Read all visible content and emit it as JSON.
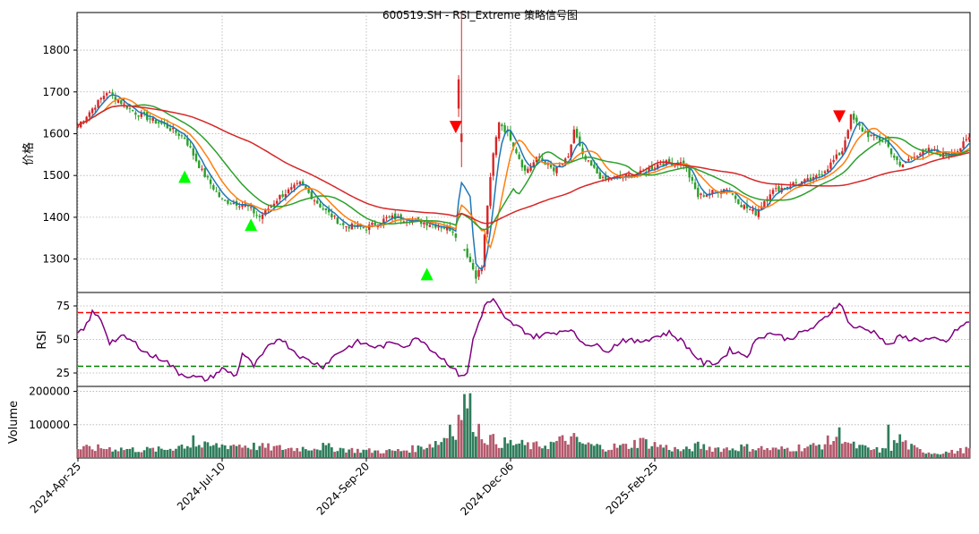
{
  "chart_data": {
    "type": "candlestick",
    "title": "600519.SH - RSI_Extreme 策略信号图",
    "grid": true,
    "x_ticks": [
      "2024-Apr-25",
      "2024-Jul-10",
      "2024-Sep-20",
      "2024-Dec-06",
      "2025-Feb-25"
    ],
    "price": {
      "ylabel": "价格",
      "ylim": [
        1220,
        1890
      ],
      "yticks": [
        1300,
        1400,
        1500,
        1600,
        1700,
        1800
      ],
      "ma_colors": {
        "ma_fast": "#1f77b4",
        "ma_mid": "#ff7f0e",
        "ma_slow": "#2ca02c",
        "ma_long": "#d62728"
      },
      "candle_up_color": "#d62728",
      "candle_down_color": "#2ca02c",
      "close_keyframes": [
        [
          0,
          1620
        ],
        [
          10,
          1700
        ],
        [
          20,
          1650
        ],
        [
          30,
          1620
        ],
        [
          37,
          1590
        ],
        [
          43,
          1510
        ],
        [
          50,
          1440
        ],
        [
          58,
          1430
        ],
        [
          63,
          1400
        ],
        [
          70,
          1450
        ],
        [
          77,
          1480
        ],
        [
          85,
          1420
        ],
        [
          92,
          1380
        ],
        [
          100,
          1375
        ],
        [
          108,
          1400
        ],
        [
          115,
          1395
        ],
        [
          122,
          1385
        ],
        [
          130,
          1370
        ],
        [
          135,
          1310
        ],
        [
          138,
          1260
        ],
        [
          140,
          1280
        ],
        [
          142,
          1430
        ],
        [
          144,
          1550
        ],
        [
          146,
          1630
        ],
        [
          150,
          1590
        ],
        [
          155,
          1510
        ],
        [
          160,
          1545
        ],
        [
          165,
          1510
        ],
        [
          170,
          1540
        ],
        [
          172,
          1610
        ],
        [
          175,
          1545
        ],
        [
          182,
          1490
        ],
        [
          188,
          1495
        ],
        [
          195,
          1505
        ],
        [
          202,
          1530
        ],
        [
          210,
          1530
        ],
        [
          215,
          1450
        ],
        [
          220,
          1460
        ],
        [
          225,
          1470
        ],
        [
          230,
          1430
        ],
        [
          235,
          1410
        ],
        [
          240,
          1460
        ],
        [
          248,
          1480
        ],
        [
          255,
          1490
        ],
        [
          260,
          1520
        ],
        [
          265,
          1560
        ],
        [
          268,
          1640
        ],
        [
          273,
          1600
        ],
        [
          280,
          1580
        ],
        [
          285,
          1520
        ],
        [
          290,
          1550
        ],
        [
          295,
          1560
        ],
        [
          300,
          1550
        ],
        [
          305,
          1560
        ],
        [
          309,
          1590
        ]
      ],
      "signals": [
        {
          "type": "buy",
          "index": 37,
          "price": 1495
        },
        {
          "type": "buy",
          "index": 60,
          "price": 1380
        },
        {
          "type": "buy",
          "index": 121,
          "price": 1262
        },
        {
          "type": "sell",
          "index": 131,
          "price": 1618
        },
        {
          "type": "sell",
          "index": 264,
          "price": 1643
        }
      ],
      "buy_color": "#00ff00",
      "sell_color": "#ff0000"
    },
    "rsi": {
      "ylabel": "RSI",
      "ylim": [
        15,
        85
      ],
      "yticks": [
        25,
        50,
        75
      ],
      "overbought": 70,
      "oversold": 30,
      "line_color": "#800080",
      "keyframes": [
        [
          0,
          54
        ],
        [
          2,
          57
        ],
        [
          5,
          70
        ],
        [
          8,
          65
        ],
        [
          11,
          48
        ],
        [
          16,
          52
        ],
        [
          20,
          47
        ],
        [
          25,
          38
        ],
        [
          30,
          35
        ],
        [
          35,
          25
        ],
        [
          40,
          22
        ],
        [
          45,
          20
        ],
        [
          50,
          28
        ],
        [
          55,
          23
        ],
        [
          57,
          40
        ],
        [
          61,
          30
        ],
        [
          66,
          44
        ],
        [
          70,
          52
        ],
        [
          73,
          45
        ],
        [
          78,
          36
        ],
        [
          85,
          30
        ],
        [
          90,
          40
        ],
        [
          97,
          48
        ],
        [
          104,
          44
        ],
        [
          110,
          48
        ],
        [
          114,
          45
        ],
        [
          118,
          52
        ],
        [
          124,
          40
        ],
        [
          128,
          33
        ],
        [
          132,
          24
        ],
        [
          135,
          24
        ],
        [
          137,
          50
        ],
        [
          141,
          75
        ],
        [
          144,
          80
        ],
        [
          148,
          65
        ],
        [
          152,
          60
        ],
        [
          158,
          52
        ],
        [
          165,
          55
        ],
        [
          170,
          58
        ],
        [
          175,
          48
        ],
        [
          180,
          45
        ],
        [
          184,
          42
        ],
        [
          189,
          50
        ],
        [
          194,
          48
        ],
        [
          200,
          52
        ],
        [
          205,
          55
        ],
        [
          210,
          48
        ],
        [
          213,
          40
        ],
        [
          217,
          32
        ],
        [
          222,
          33
        ],
        [
          226,
          42
        ],
        [
          232,
          38
        ],
        [
          236,
          52
        ],
        [
          241,
          55
        ],
        [
          246,
          50
        ],
        [
          251,
          55
        ],
        [
          256,
          60
        ],
        [
          260,
          68
        ],
        [
          264,
          78
        ],
        [
          268,
          60
        ],
        [
          272,
          58
        ],
        [
          277,
          55
        ],
        [
          281,
          45
        ],
        [
          285,
          52
        ],
        [
          290,
          50
        ],
        [
          296,
          50
        ],
        [
          301,
          48
        ],
        [
          305,
          58
        ],
        [
          309,
          63
        ]
      ]
    },
    "volume": {
      "ylabel": "Volume",
      "ylim": [
        0,
        215000
      ],
      "yticks": [
        100000,
        200000
      ],
      "tick_labels": [
        "100000",
        "200000"
      ],
      "keyframes": [
        [
          0,
          28000
        ],
        [
          10,
          30000
        ],
        [
          20,
          25000
        ],
        [
          30,
          25000
        ],
        [
          37,
          40000
        ],
        [
          45,
          35000
        ],
        [
          55,
          40000
        ],
        [
          65,
          32000
        ],
        [
          75,
          28000
        ],
        [
          85,
          34000
        ],
        [
          95,
          24000
        ],
        [
          105,
          20000
        ],
        [
          112,
          22000
        ],
        [
          118,
          30000
        ],
        [
          122,
          42000
        ],
        [
          126,
          50000
        ],
        [
          128,
          70000
        ],
        [
          131,
          90000
        ],
        [
          133,
          145000
        ],
        [
          135,
          170000
        ],
        [
          137,
          120000
        ],
        [
          140,
          70000
        ],
        [
          145,
          48000
        ],
        [
          152,
          42000
        ],
        [
          158,
          35000
        ],
        [
          164,
          42000
        ],
        [
          170,
          58000
        ],
        [
          176,
          40000
        ],
        [
          182,
          32000
        ],
        [
          190,
          35000
        ],
        [
          195,
          50000
        ],
        [
          200,
          40000
        ],
        [
          205,
          30000
        ],
        [
          210,
          22000
        ],
        [
          215,
          36000
        ],
        [
          220,
          30000
        ],
        [
          225,
          28000
        ],
        [
          230,
          32000
        ],
        [
          236,
          30000
        ],
        [
          242,
          25000
        ],
        [
          250,
          32000
        ],
        [
          256,
          35000
        ],
        [
          262,
          55000
        ],
        [
          264,
          80000
        ],
        [
          268,
          38000
        ],
        [
          275,
          25000
        ],
        [
          281,
          22000
        ],
        [
          285,
          60000
        ],
        [
          288,
          35000
        ],
        [
          292,
          22000
        ],
        [
          297,
          15000
        ],
        [
          303,
          18000
        ],
        [
          309,
          26000
        ]
      ],
      "spikes": [
        [
          134,
          192000
        ],
        [
          129,
          100000
        ],
        [
          281,
          100000
        ],
        [
          264,
          92000
        ],
        [
          172,
          75000
        ],
        [
          195,
          60000
        ],
        [
          40,
          68000
        ]
      ],
      "up_color": "#b4596c",
      "down_color": "#2e7d5b"
    }
  }
}
